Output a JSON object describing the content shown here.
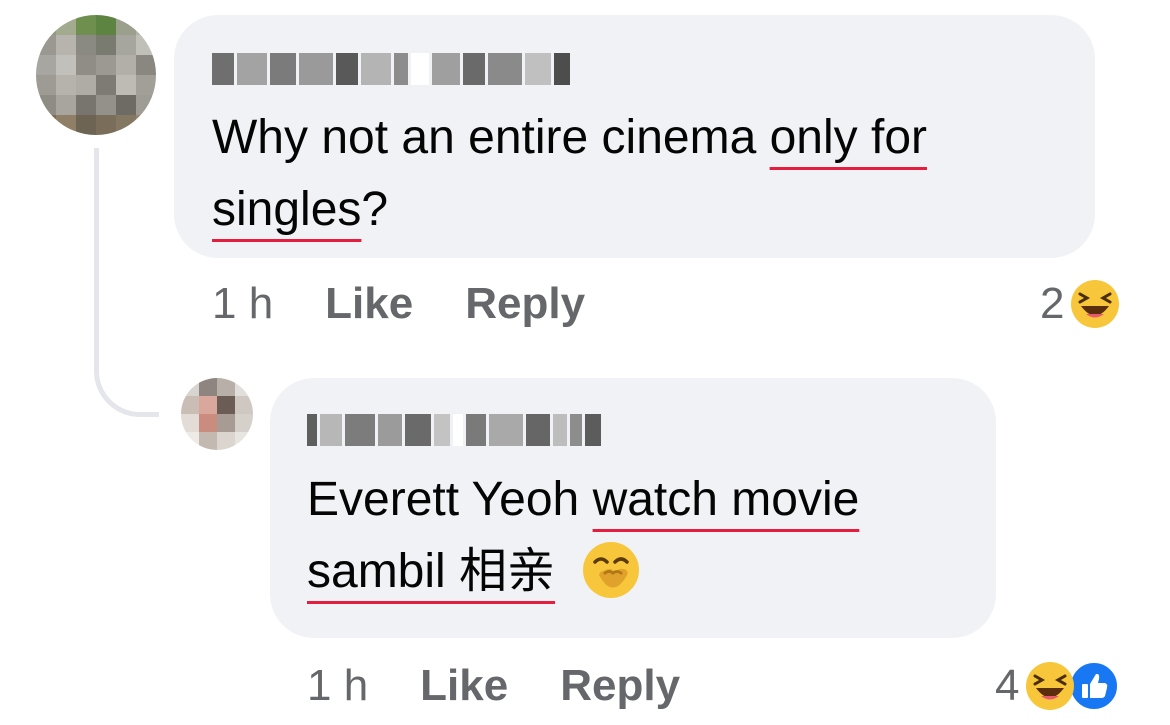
{
  "comments": [
    {
      "author_redacted": true,
      "text_pre": "Why not an entire cinema ",
      "text_ul1": "only for",
      "text_ul2": "singles",
      "text_post": "?",
      "time": "1 h",
      "like_label": "Like",
      "reply_label": "Reply",
      "reaction_count": "2",
      "reactions": [
        "haha-icon"
      ]
    },
    {
      "author_redacted": true,
      "text_pre": "Everett Yeoh ",
      "text_ul1": "watch movie",
      "text_ul2": "sambil 相亲",
      "text_post": "",
      "emoji": "🤭",
      "time": "1 h",
      "like_label": "Like",
      "reply_label": "Reply",
      "reaction_count": "4",
      "reactions": [
        "haha-icon",
        "like-icon"
      ]
    }
  ],
  "colors": {
    "bubble": "#f0f2f5",
    "meta_text": "#65676b",
    "underline": "#e41e3f",
    "like_blue": "#1877f2",
    "haha_yellow": "#f7c63a"
  }
}
